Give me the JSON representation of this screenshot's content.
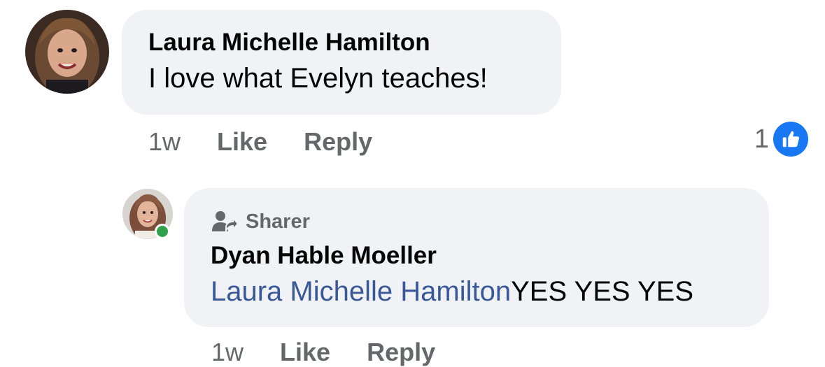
{
  "comments": [
    {
      "author": "Laura Michelle Hamilton",
      "text": "I love what Evelyn teaches!",
      "avatar_icon": "profile-photo",
      "time": "1w",
      "like_label": "Like",
      "reply_label": "Reply",
      "reaction_count": "1",
      "reaction_icon": "like-thumb-icon"
    }
  ],
  "reply": {
    "badge_icon": "sharer-icon",
    "badge_label": "Sharer",
    "author": "Dyan Hable Moeller",
    "mention": "Laura Michelle Hamilton",
    "text": "YES YES YES",
    "avatar_icon": "profile-photo",
    "online": true,
    "time": "1w",
    "like_label": "Like",
    "reply_label": "Reply"
  },
  "colors": {
    "bubble": "#f0f2f5",
    "link": "#385898",
    "meta": "#65676b",
    "like_blue": "#1877f2",
    "online_green": "#31a24c"
  }
}
